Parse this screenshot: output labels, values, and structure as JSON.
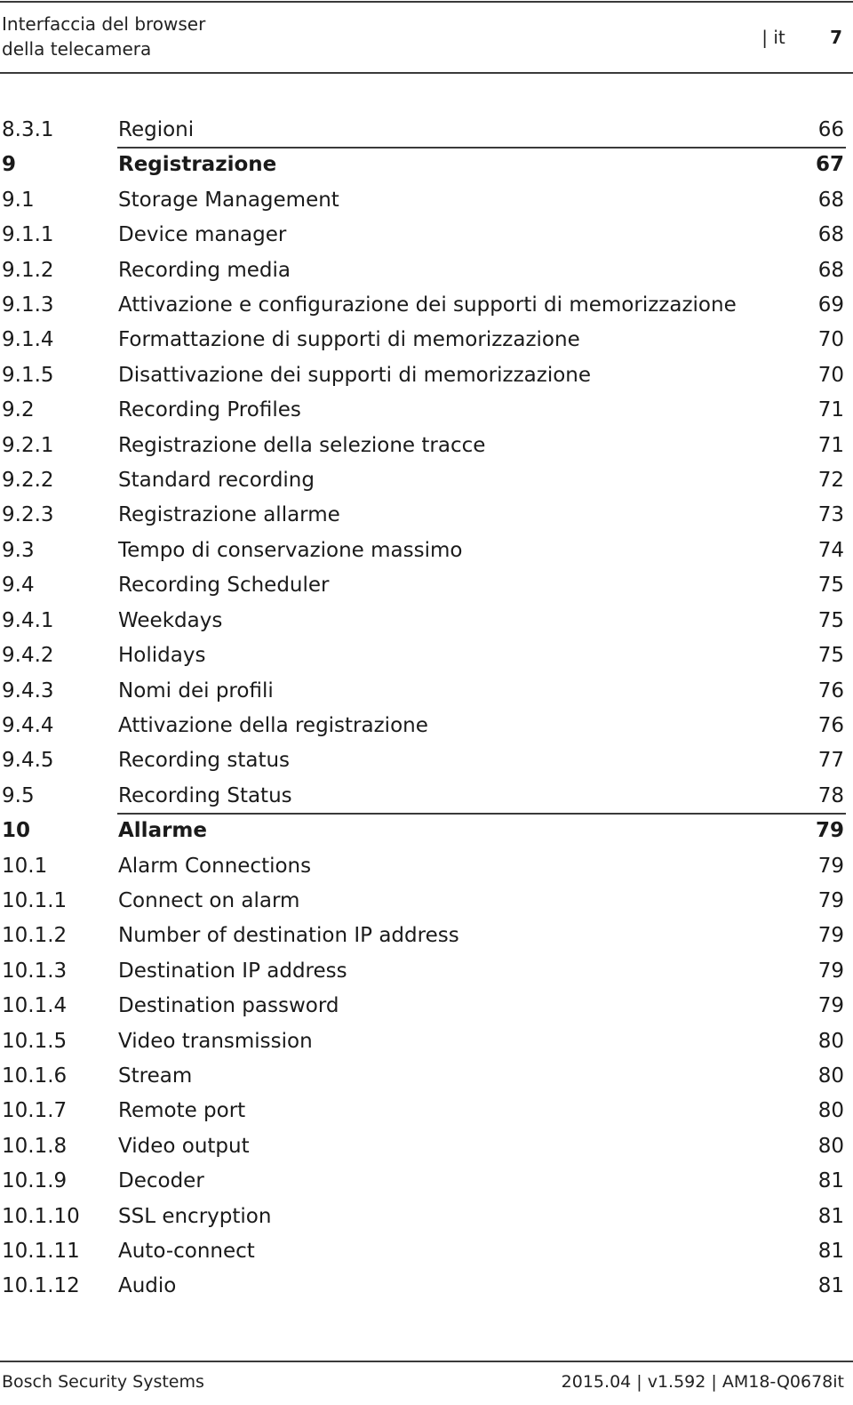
{
  "header": {
    "title": "Interfaccia del browser\ndella telecamera",
    "lang": "| it",
    "page_number": "7"
  },
  "toc": [
    {
      "num": "8.3.1",
      "title": "Regioni",
      "page": "66",
      "chapter": false
    },
    {
      "num": "9",
      "title": "Registrazione",
      "page": "67",
      "chapter": true
    },
    {
      "num": "9.1",
      "title": "Storage Management",
      "page": "68",
      "chapter": false
    },
    {
      "num": "9.1.1",
      "title": "Device manager",
      "page": "68",
      "chapter": false
    },
    {
      "num": "9.1.2",
      "title": "Recording media",
      "page": "68",
      "chapter": false
    },
    {
      "num": "9.1.3",
      "title": "Attivazione e configurazione dei supporti di memorizzazione",
      "page": "69",
      "chapter": false
    },
    {
      "num": "9.1.4",
      "title": "Formattazione di supporti di memorizzazione",
      "page": "70",
      "chapter": false
    },
    {
      "num": "9.1.5",
      "title": "Disattivazione dei supporti di memorizzazione",
      "page": "70",
      "chapter": false
    },
    {
      "num": "9.2",
      "title": "Recording Profiles",
      "page": "71",
      "chapter": false
    },
    {
      "num": "9.2.1",
      "title": "Registrazione della selezione tracce",
      "page": "71",
      "chapter": false
    },
    {
      "num": "9.2.2",
      "title": "Standard recording",
      "page": "72",
      "chapter": false
    },
    {
      "num": "9.2.3",
      "title": "Registrazione allarme",
      "page": "73",
      "chapter": false
    },
    {
      "num": "9.3",
      "title": "Tempo di conservazione massimo",
      "page": "74",
      "chapter": false
    },
    {
      "num": "9.4",
      "title": "Recording Scheduler",
      "page": "75",
      "chapter": false
    },
    {
      "num": "9.4.1",
      "title": "Weekdays",
      "page": "75",
      "chapter": false
    },
    {
      "num": "9.4.2",
      "title": "Holidays",
      "page": "75",
      "chapter": false
    },
    {
      "num": "9.4.3",
      "title": "Nomi dei profili",
      "page": "76",
      "chapter": false
    },
    {
      "num": "9.4.4",
      "title": "Attivazione della registrazione",
      "page": "76",
      "chapter": false
    },
    {
      "num": "9.4.5",
      "title": "Recording status",
      "page": "77",
      "chapter": false
    },
    {
      "num": "9.5",
      "title": "Recording Status",
      "page": "78",
      "chapter": false
    },
    {
      "num": "10",
      "title": "Allarme",
      "page": "79",
      "chapter": true
    },
    {
      "num": "10.1",
      "title": "Alarm Connections",
      "page": "79",
      "chapter": false
    },
    {
      "num": "10.1.1",
      "title": "Connect on alarm",
      "page": "79",
      "chapter": false
    },
    {
      "num": "10.1.2",
      "title": "Number of destination IP address",
      "page": "79",
      "chapter": false
    },
    {
      "num": "10.1.3",
      "title": "Destination IP address",
      "page": "79",
      "chapter": false
    },
    {
      "num": "10.1.4",
      "title": "Destination password",
      "page": "79",
      "chapter": false
    },
    {
      "num": "10.1.5",
      "title": "Video transmission",
      "page": "80",
      "chapter": false
    },
    {
      "num": "10.1.6",
      "title": "Stream",
      "page": "80",
      "chapter": false
    },
    {
      "num": "10.1.7",
      "title": "Remote port",
      "page": "80",
      "chapter": false
    },
    {
      "num": "10.1.8",
      "title": "Video output",
      "page": "80",
      "chapter": false
    },
    {
      "num": "10.1.9",
      "title": "Decoder",
      "page": "81",
      "chapter": false
    },
    {
      "num": "10.1.10",
      "title": "SSL encryption",
      "page": "81",
      "chapter": false
    },
    {
      "num": "10.1.11",
      "title": "Auto-connect",
      "page": "81",
      "chapter": false
    },
    {
      "num": "10.1.12",
      "title": "Audio",
      "page": "81",
      "chapter": false
    }
  ],
  "footer": {
    "left": "Bosch Security Systems",
    "right": "2015.04 | v1.592 | AM18-Q0678it"
  }
}
